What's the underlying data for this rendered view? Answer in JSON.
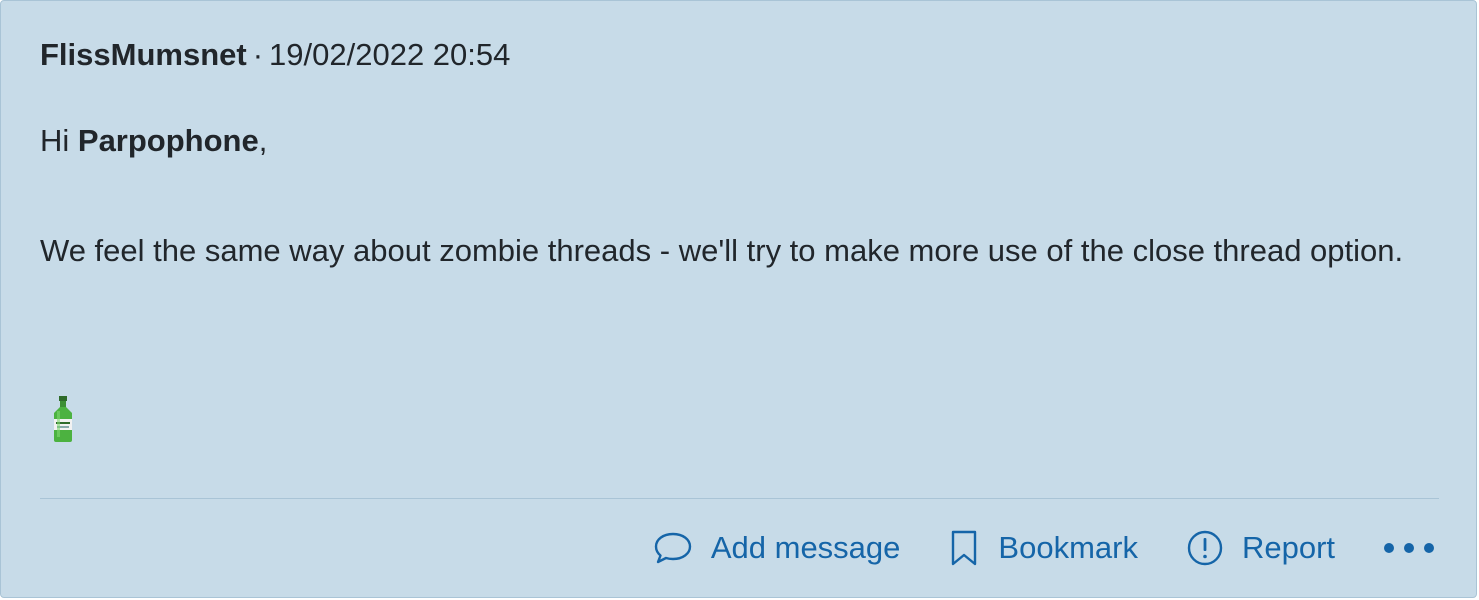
{
  "post": {
    "author": "FlissMumsnet",
    "separator": "·",
    "timestamp": "19/02/2022 20:54",
    "greeting_prefix": "Hi ",
    "greeting_name": "Parpophone",
    "greeting_suffix": ",",
    "body_text": "We feel the same way about zombie threads - we'll try to make more use of the close thread option.",
    "emoji": "gin-bottle"
  },
  "actions": {
    "add_message_label": "Add message",
    "bookmark_label": "Bookmark",
    "report_label": "Report",
    "more_icon": "more-dots-icon"
  },
  "colors": {
    "background": "#c7dbe8",
    "text": "#21262b",
    "link": "#1565a8"
  }
}
